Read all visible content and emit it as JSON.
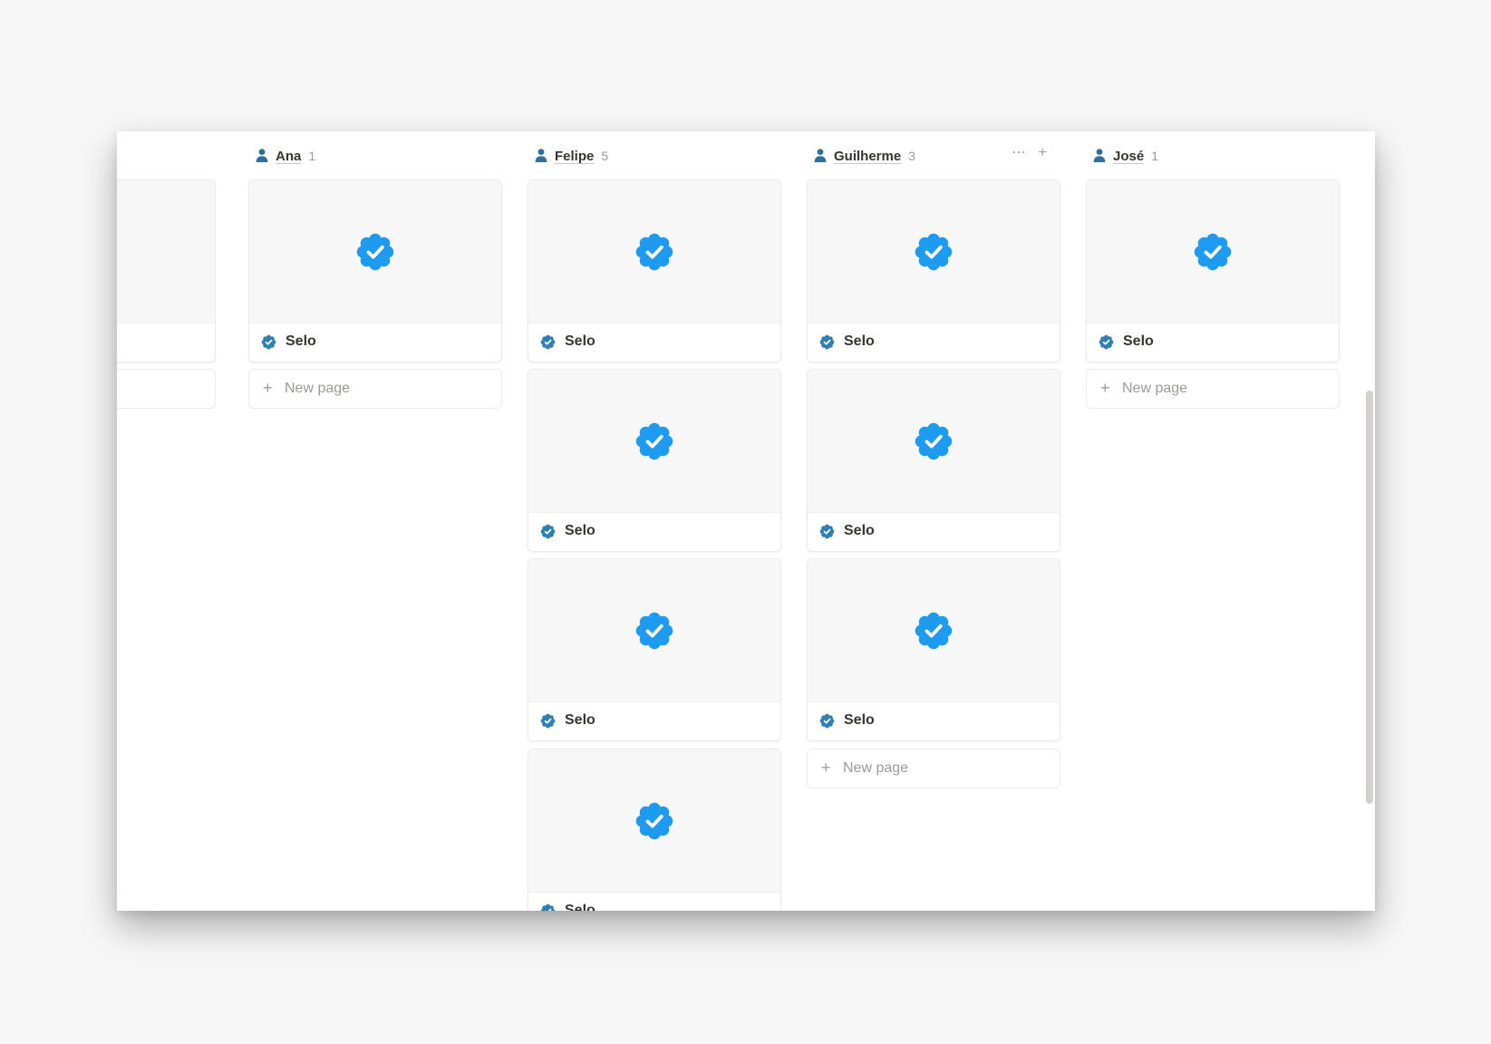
{
  "board": {
    "columns": [
      {
        "key": "partial",
        "title": "",
        "count": "",
        "cards": [
          {
            "title": ""
          }
        ],
        "new_page": true
      },
      {
        "key": "ana",
        "title": "Ana",
        "count": "1",
        "cards": [
          {
            "title": "Selo"
          }
        ],
        "new_page": true
      },
      {
        "key": "felipe",
        "title": "Felipe",
        "count": "5",
        "cards": [
          {
            "title": "Selo"
          },
          {
            "title": "Selo"
          },
          {
            "title": "Selo"
          },
          {
            "title": "Selo"
          }
        ],
        "new_page": false
      },
      {
        "key": "guilherme",
        "title": "Guilherme",
        "count": "3",
        "cards": [
          {
            "title": "Selo"
          },
          {
            "title": "Selo"
          },
          {
            "title": "Selo"
          }
        ],
        "new_page": true,
        "actions": [
          "more-icon",
          "plus-icon"
        ]
      },
      {
        "key": "jose",
        "title": "José",
        "count": "1",
        "cards": [
          {
            "title": "Selo"
          }
        ],
        "new_page": true
      }
    ],
    "new_page_label": "New page",
    "column_icon": "person-icon",
    "card_icon": "verified-badge-icon"
  },
  "colors": {
    "badge_blue": "#1d9bf0",
    "small_badge_blue": "#2e7fb5",
    "person_icon": "#2f6f9e",
    "background": "#f7f7f7"
  }
}
